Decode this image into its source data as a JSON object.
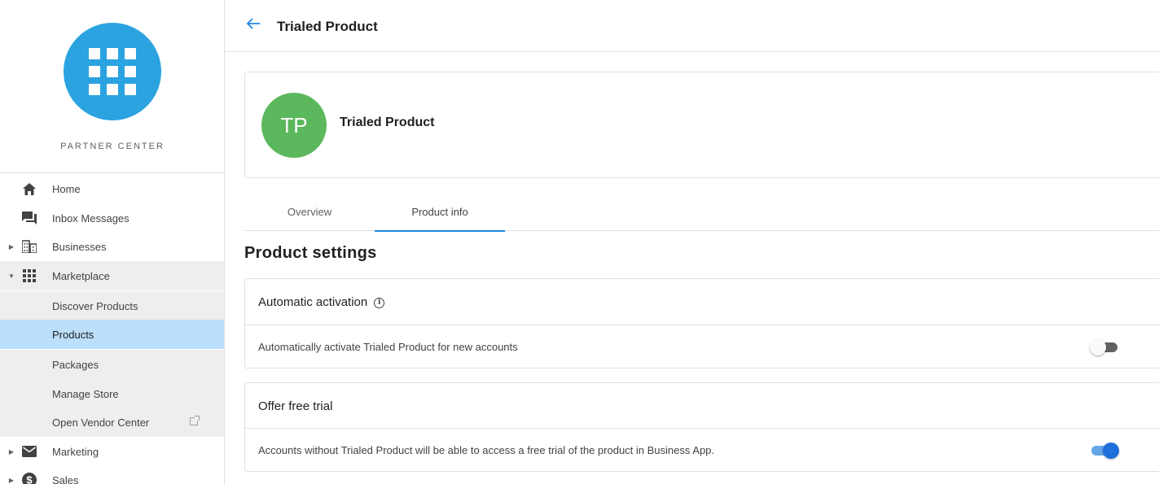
{
  "sidebar": {
    "brand_name": "PARTNER CENTER",
    "nav": {
      "home": "Home",
      "inbox": "Inbox Messages",
      "businesses": "Businesses",
      "marketplace": "Marketplace",
      "marketing": "Marketing",
      "sales": "Sales"
    },
    "marketplace_items": {
      "discover": "Discover Products",
      "products": "Products",
      "packages": "Packages",
      "manage_store": "Manage Store",
      "vendor_center": "Open Vendor Center"
    },
    "active_item": "Products"
  },
  "header": {
    "title": "Trialed Product"
  },
  "product": {
    "initials": "TP",
    "name": "Trialed Product",
    "avatar_color": "#5cb85c"
  },
  "tabs": {
    "overview": "Overview",
    "product_info": "Product info",
    "active": "Product info"
  },
  "settings": {
    "title": "Product settings",
    "auto_activation": {
      "title": "Automatic activation",
      "description": "Automatically activate Trialed Product for new accounts",
      "enabled": false
    },
    "free_trial": {
      "title": "Offer free trial",
      "description": "Accounts without Trialed Product will be able to access a free trial of the product in Business App.",
      "enabled": true
    }
  },
  "colors": {
    "accent": "#1e88e5",
    "brand": "#2aa3e0",
    "active_nav": "#bbdefb"
  }
}
